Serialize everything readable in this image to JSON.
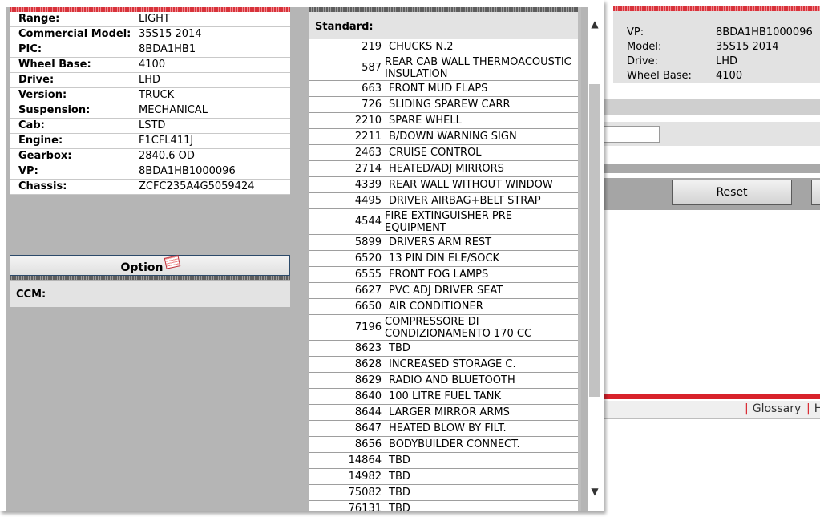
{
  "vehicle_info": [
    {
      "label": "Range:",
      "value": "LIGHT"
    },
    {
      "label": "Commercial Model:",
      "value": "35S15 2014"
    },
    {
      "label": "PIC:",
      "value": "8BDA1HB1"
    },
    {
      "label": "Wheel Base:",
      "value": "4100"
    },
    {
      "label": "Drive:",
      "value": "LHD"
    },
    {
      "label": "Version:",
      "value": "TRUCK"
    },
    {
      "label": "Suspension:",
      "value": "MECHANICAL"
    },
    {
      "label": "Cab:",
      "value": "LSTD"
    },
    {
      "label": "Engine:",
      "value": "F1CFL411J"
    },
    {
      "label": "Gearbox:",
      "value": "2840.6 OD"
    },
    {
      "label": "VP:",
      "value": "8BDA1HB1000096"
    },
    {
      "label": "Chassis:",
      "value": "ZCFC235A4G5059424"
    }
  ],
  "option": {
    "label": "Option",
    "icon": "option-edit-icon"
  },
  "ccm": {
    "label": "CCM:"
  },
  "standard": {
    "header": "Standard:",
    "items": [
      {
        "code": "219",
        "desc": "CHUCKS N.2"
      },
      {
        "code": "587",
        "desc": "REAR CAB WALL THERMOACOUSTIC INSULATION"
      },
      {
        "code": "663",
        "desc": "FRONT MUD FLAPS"
      },
      {
        "code": "726",
        "desc": "SLIDING SPAREW CARR"
      },
      {
        "code": "2210",
        "desc": "SPARE WHELL"
      },
      {
        "code": "2211",
        "desc": "B/DOWN WARNING SIGN"
      },
      {
        "code": "2463",
        "desc": "CRUISE CONTROL"
      },
      {
        "code": "2714",
        "desc": "HEATED/ADJ MIRRORS"
      },
      {
        "code": "4339",
        "desc": "REAR WALL WITHOUT WINDOW"
      },
      {
        "code": "4495",
        "desc": "DRIVER AIRBAG+BELT STRAP"
      },
      {
        "code": "4544",
        "desc": "FIRE EXTINGUISHER PRE EQUIPMENT"
      },
      {
        "code": "5899",
        "desc": "DRIVERS ARM REST"
      },
      {
        "code": "6520",
        "desc": "13 PIN DIN ELE/SOCK"
      },
      {
        "code": "6555",
        "desc": "FRONT FOG LAMPS"
      },
      {
        "code": "6627",
        "desc": "PVC ADJ DRIVER SEAT"
      },
      {
        "code": "6650",
        "desc": "AIR CONDITIONER"
      },
      {
        "code": "7196",
        "desc": "COMPRESSORE DI CONDIZIONAMENTO 170 CC"
      },
      {
        "code": "8623",
        "desc": "TBD"
      },
      {
        "code": "8628",
        "desc": "INCREASED STORAGE C."
      },
      {
        "code": "8629",
        "desc": "RADIO AND BLUETOOTH"
      },
      {
        "code": "8640",
        "desc": "100 LITRE FUEL TANK"
      },
      {
        "code": "8644",
        "desc": "LARGER MIRROR ARMS"
      },
      {
        "code": "8647",
        "desc": "HEATED BLOW BY FILT."
      },
      {
        "code": "8656",
        "desc": "BODYBUILDER CONNECT."
      },
      {
        "code": "14864",
        "desc": "TBD"
      },
      {
        "code": "14982",
        "desc": "TBD"
      },
      {
        "code": "75082",
        "desc": "TBD"
      },
      {
        "code": "76131",
        "desc": "TBD"
      }
    ]
  },
  "scrollbar": {
    "up_icon": "▲",
    "down_icon": "▼"
  },
  "background_page": {
    "info": [
      {
        "label": "VP:",
        "value": "8BDA1HB1000096"
      },
      {
        "label": "Model:",
        "value": "35S15 2014"
      },
      {
        "label": "Drive:",
        "value": "LHD"
      },
      {
        "label": "Wheel Base:",
        "value": "4100"
      }
    ],
    "reset_label": "Reset",
    "glossary_label": "Glossary",
    "next_link_label": "H",
    "accent_color": "#d8222b"
  }
}
